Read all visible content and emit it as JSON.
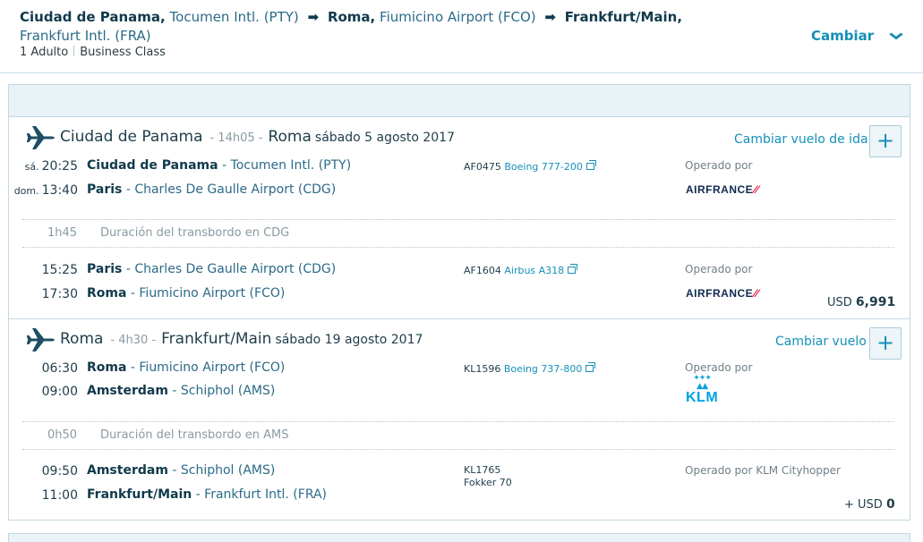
{
  "header": {
    "route": {
      "origin_city": "Ciudad de Panama,",
      "origin_airport": "Tocumen Intl. (PTY)",
      "via_city": "Roma,",
      "via_airport": "Fiumicino Airport (FCO)",
      "dest_city": "Frankfurt/Main,",
      "dest_airport": "Frankfurt Intl. (FRA)",
      "arrow": "➡"
    },
    "passengers": "1 Adulto",
    "cabin": "Business Class",
    "change_label": "Cambiar",
    "change_icon": "chevron-down-icon"
  },
  "outbound": {
    "origin": "Ciudad de Panama",
    "duration": "- 14h05 -",
    "destination": "Roma",
    "date": "sábado 5 agosto 2017",
    "change_label": "Cambiar vuelo de ida",
    "plus": "+",
    "legs": [
      {
        "dep_day": "sá.",
        "dep_time": "20:25",
        "dep_city": "Ciudad de Panama",
        "dep_airport": " - Tocumen Intl. (PTY)",
        "arr_day": "dom.",
        "arr_time": "13:40",
        "arr_city": "Paris",
        "arr_airport": " - Charles De Gaulle Airport (CDG)",
        "flight": "AF0475",
        "aircraft": "Boeing 777-200",
        "operated": "Operado por",
        "airline_logo": "AIRFRANCE"
      },
      {
        "dep_time": "15:25",
        "dep_city": "Paris",
        "dep_airport": " - Charles De Gaulle Airport (CDG)",
        "arr_time": "17:30",
        "arr_city": "Roma",
        "arr_airport": " - Fiumicino Airport (FCO)",
        "flight": "AF1604",
        "aircraft": "Airbus A318",
        "operated": "Operado por",
        "airline_logo": "AIRFRANCE"
      }
    ],
    "transfer": {
      "duration": "1h45",
      "text": "Duración del transbordo en CDG"
    },
    "price_currency": "USD",
    "price_value": "6,991"
  },
  "return": {
    "origin": "Roma",
    "duration": "- 4h30 -",
    "destination": "Frankfurt/Main",
    "date": "sábado 19 agosto 2017",
    "change_label": "Cambiar vuelo",
    "plus": "+",
    "legs": [
      {
        "dep_time": "06:30",
        "dep_city": "Roma",
        "dep_airport": " - Fiumicino Airport (FCO)",
        "arr_time": "09:00",
        "arr_city": "Amsterdam",
        "arr_airport": " - Schiphol (AMS)",
        "flight": "KL1596",
        "aircraft": "Boeing 737-800",
        "operated": "Operado por",
        "airline_logo": "KLM"
      },
      {
        "dep_time": "09:50",
        "dep_city": "Amsterdam",
        "dep_airport": " - Schiphol (AMS)",
        "arr_time": "11:00",
        "arr_city": "Frankfurt/Main",
        "arr_airport": " - Frankfurt Intl. (FRA)",
        "flight": "KL1765",
        "aircraft": "Fokker 70",
        "operated": "Operado por KLM Cityhopper"
      }
    ],
    "transfer": {
      "duration": "0h50",
      "text": "Duración del transbordo en AMS"
    },
    "price_prefix": "+ USD",
    "price_value": "0"
  },
  "colors": {
    "accent": "#1590b8",
    "navy": "#113a4c",
    "border": "#c4d9e2",
    "af_red": "#e4002b",
    "klm_blue": "#00a1de"
  }
}
